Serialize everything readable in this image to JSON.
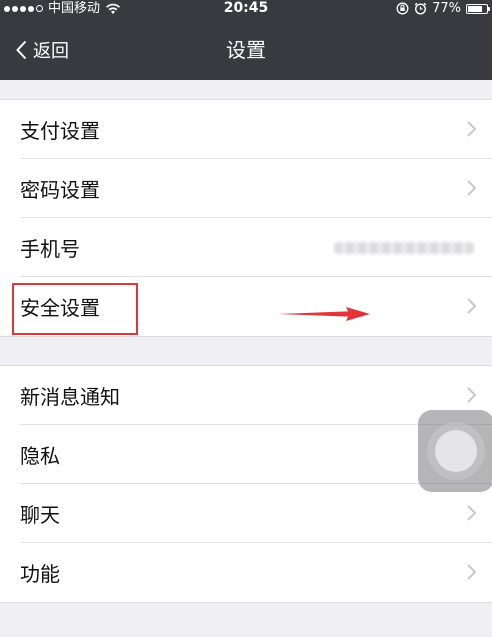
{
  "status_bar": {
    "carrier": "中国移动",
    "time": "20:45",
    "battery": "77%",
    "battery_level": 0.77,
    "icons": [
      "signal-dots-icon",
      "wifi-icon",
      "rotation-lock-icon",
      "alarm-icon",
      "battery-icon"
    ]
  },
  "navbar": {
    "back_label": "返回",
    "title": "设置"
  },
  "groups": [
    {
      "items": [
        {
          "label": "支付设置"
        },
        {
          "label": "密码设置"
        },
        {
          "label": "手机号",
          "value_hidden": true
        },
        {
          "label": "安全设置",
          "highlighted": true
        }
      ]
    },
    {
      "items": [
        {
          "label": "新消息通知"
        },
        {
          "label": "隐私"
        },
        {
          "label": "聊天"
        },
        {
          "label": "功能"
        }
      ]
    }
  ],
  "annotation": {
    "highlight_color": "#e2353a",
    "arrow_color": "#e2353a"
  },
  "colors": {
    "header_bg": "#393a3f",
    "page_bg": "#efeff4",
    "cell_bg": "#ffffff"
  }
}
